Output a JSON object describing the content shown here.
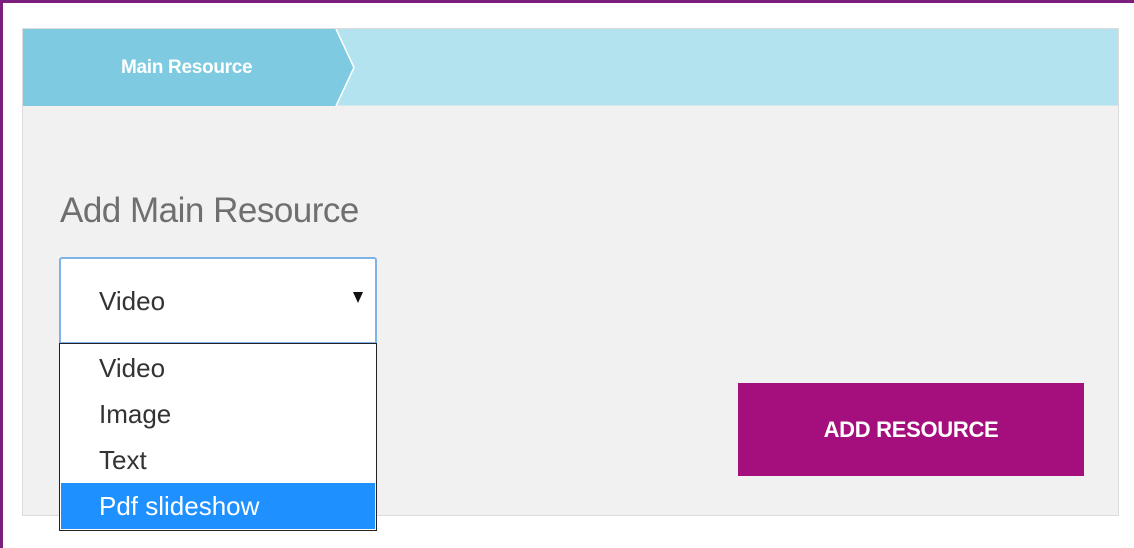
{
  "tabs": [
    {
      "label": "Main Resource",
      "active": true
    }
  ],
  "section": {
    "title": "Add Main Resource"
  },
  "resource_type_select": {
    "selected_value": "Video",
    "icon": "chevron-down-icon",
    "options": [
      "Video",
      "Image",
      "Text",
      "Pdf slideshow"
    ],
    "highlighted_option": "Pdf slideshow"
  },
  "add_button": {
    "label": "ADD RESOURCE"
  },
  "colors": {
    "frame_border": "#7b1f7e",
    "tab_strip": "#b3e3ef",
    "tab_active": "#7ecbe1",
    "panel_background": "#f1f1f1",
    "primary_button": "#a50e7d",
    "select_focus_border": "#7fb2e6",
    "option_highlight": "#1e90ff"
  }
}
